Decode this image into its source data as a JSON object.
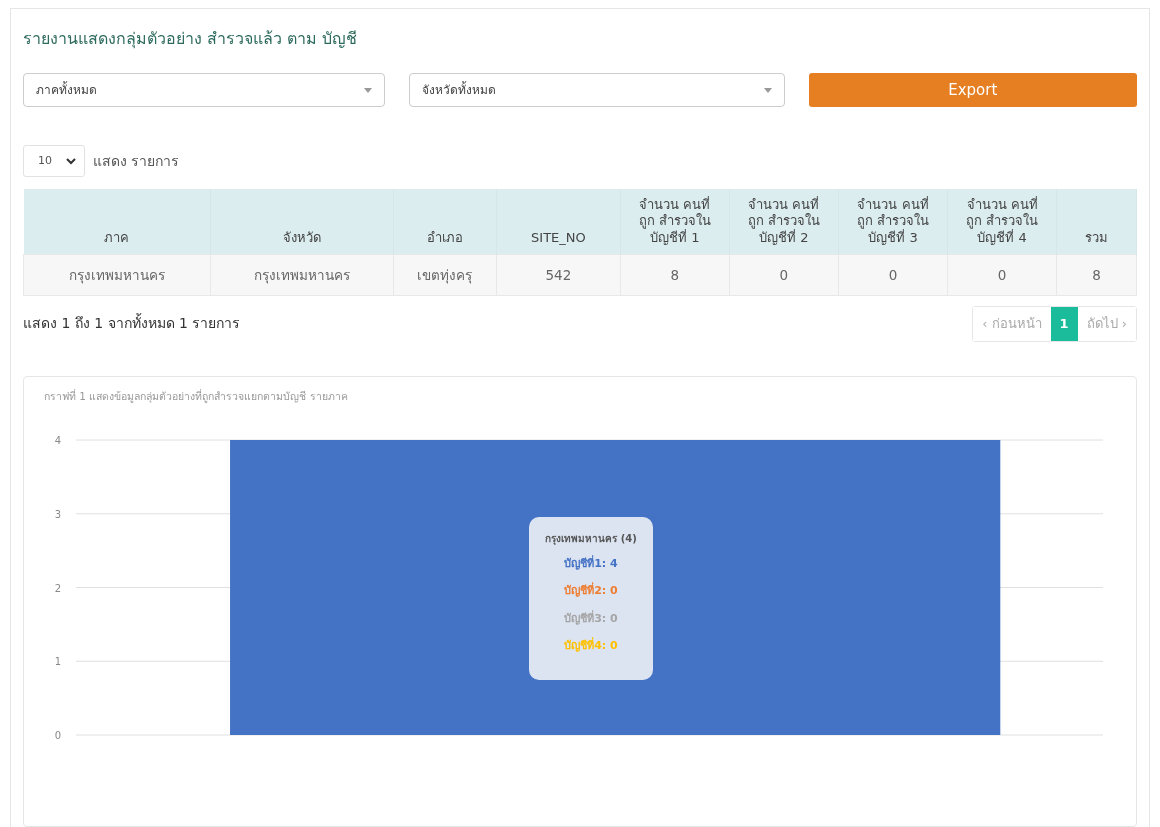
{
  "title": "รายงานแสดงกลุ่มตัวอย่าง สำรวจแล้ว ตาม บัญชี",
  "filters": [
    {
      "value": "ภาคทั้งหมด"
    },
    {
      "value": "จังหวัดทั้งหมด"
    }
  ],
  "export_button": "Export",
  "page_length": {
    "value": "10",
    "label": "แสดง รายการ"
  },
  "table": {
    "columns": [
      "ภาค",
      "จังหวัด",
      "อำเภอ",
      "SITE_NO",
      "จำนวน คนที่ถูก สำรวจใน บัญชีที่ 1",
      "จำนวน คนที่ถูก สำรวจใน บัญชีที่ 2",
      "จำนวน คนที่ถูก สำรวจใน บัญชีที่ 3",
      "จำนวน คนที่ถูก สำรวจใน บัญชีที่ 4",
      "รวม"
    ],
    "rows": [
      [
        "กรุงเทพมหานคร",
        "กรุงเทพมหานคร",
        "เขตทุ่งครุ",
        "542",
        "8",
        "0",
        "0",
        "0",
        "8"
      ]
    ]
  },
  "info": "แสดง 1 ถึง 1 จากทั้งหมด 1 รายการ",
  "pagination": [
    {
      "label": "‹ ก่อนหน้า",
      "disabled": true,
      "selected": false
    },
    {
      "label": "1",
      "disabled": false,
      "selected": true
    },
    {
      "label": "ถัดไป ›",
      "disabled": true,
      "selected": false
    }
  ],
  "chart": {
    "chart_data": {
      "type": "bar",
      "title": "กราฟที่ 1 แสดงข้อมูลกลุ่มตัวอย่างที่ถูกสำรวจแยกตามบัญชี รายภาค",
      "stacked": true,
      "grid": true,
      "ylim": [
        0,
        4
      ],
      "yticks": [
        0,
        1,
        2,
        3,
        4
      ],
      "series": [
        {
          "color": "#4472c4",
          "values": [
            4
          ]
        },
        {
          "color": "#ed7d31",
          "values": [
            0
          ]
        },
        {
          "color": "#a5a5a5",
          "values": [
            0
          ]
        },
        {
          "color": "#ffc000",
          "values": [
            0
          ]
        }
      ]
    },
    "tooltip": {
      "title": "กรุงเทพมหานคร (4)",
      "lines": [
        "บัญชีที่1: 4",
        "บัญชีที่2: 0",
        "บัญชีที่3: 0",
        "บัญชีที่4: 0"
      ]
    }
  }
}
